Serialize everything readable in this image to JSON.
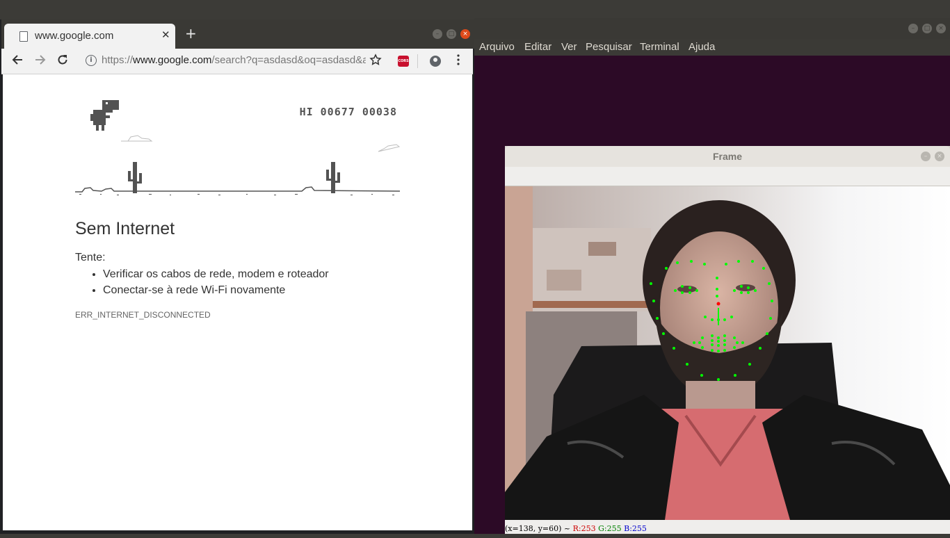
{
  "terminal": {
    "menu": [
      "Arquivo",
      "Editar",
      "Ver",
      "Pesquisar",
      "Terminal",
      "Ajuda"
    ]
  },
  "browser": {
    "tab_title": "www.google.com",
    "new_tab_label": "+",
    "url_prefix": "https://",
    "url_host": "www.google.com",
    "url_path": "/search?q=asdasd&oq=asdasd&a...",
    "extension_label": "CORS",
    "page": {
      "score": "HI 00677 00038",
      "title": "Sem Internet",
      "suggestions_label": "Tente:",
      "suggestions": [
        "Verificar os cabos de rede, modem e roteador",
        "Conectar-se à rede Wi-Fi novamente"
      ],
      "error_code": "ERR_INTERNET_DISCONNECTED"
    }
  },
  "frame_window": {
    "title": "Frame",
    "status": {
      "coords": "(x=138, y=60) ~ ",
      "r": "R:253",
      "g": "G:255",
      "b": "B:255"
    },
    "landmark_color": "#00ff00",
    "nose_marker_color": "#ff0000",
    "status_colors": {
      "r": "#cc0000",
      "g": "#008000",
      "b": "#0000cc"
    }
  },
  "icons": {
    "back": "arrow-left-icon",
    "forward": "arrow-right-icon",
    "reload": "reload-icon",
    "star": "star-icon",
    "menu": "kebab-menu-icon"
  }
}
